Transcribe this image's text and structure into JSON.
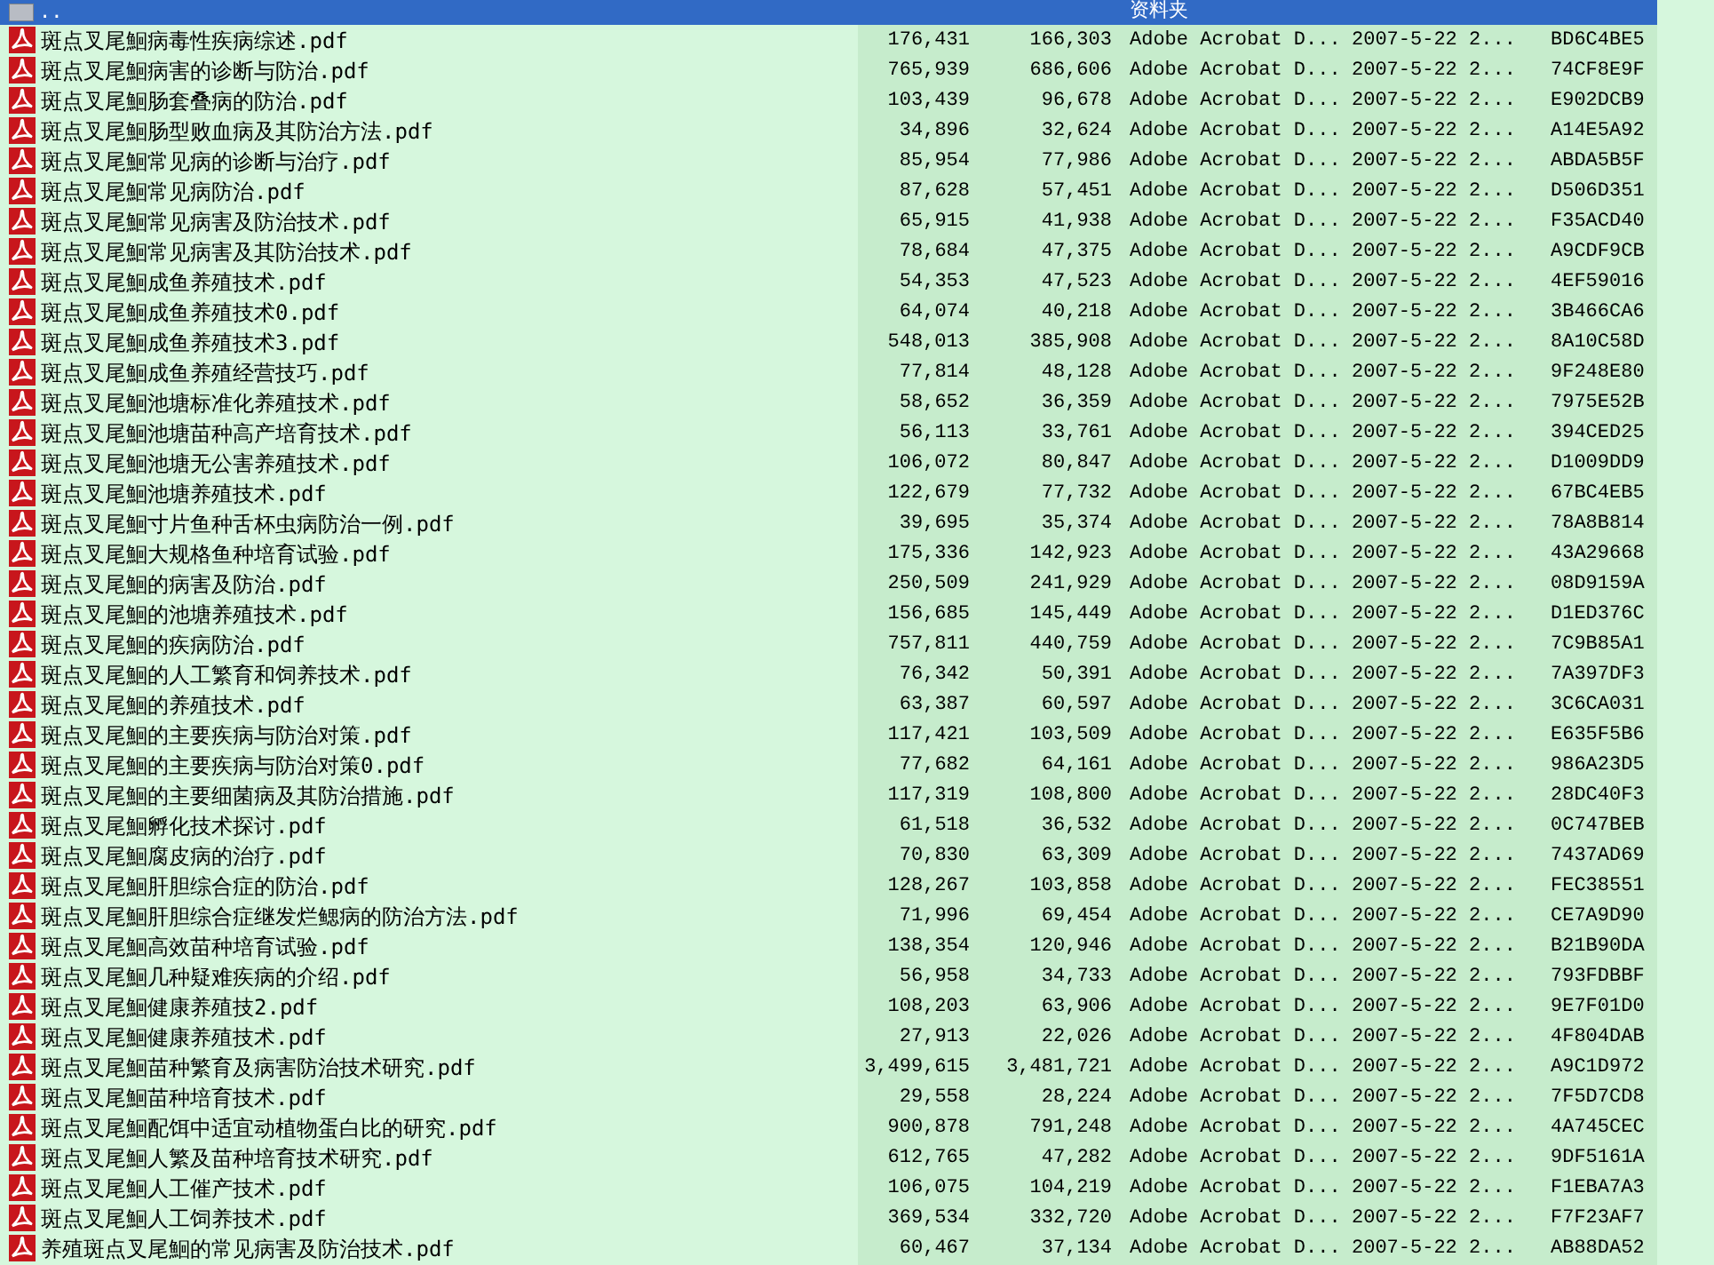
{
  "file_list": {
    "rows": [
      {
        "kind": "parent",
        "name": "..",
        "type": "资料夹",
        "selected": true
      },
      {
        "kind": "file",
        "name": "斑点叉尾鮰病毒性疾病综述.pdf",
        "size": "176,431",
        "packed": "166,303",
        "type": "Adobe Acrobat D...",
        "modified": "2007-5-22 2...",
        "crc": "BD6C4BE5",
        "selected": false
      },
      {
        "kind": "file",
        "name": "斑点叉尾鮰病害的诊断与防治.pdf",
        "size": "765,939",
        "packed": "686,606",
        "type": "Adobe Acrobat D...",
        "modified": "2007-5-22 2...",
        "crc": "74CF8E9F",
        "selected": false
      },
      {
        "kind": "file",
        "name": "斑点叉尾鮰肠套叠病的防治.pdf",
        "size": "103,439",
        "packed": "96,678",
        "type": "Adobe Acrobat D...",
        "modified": "2007-5-22 2...",
        "crc": "E902DCB9",
        "selected": false
      },
      {
        "kind": "file",
        "name": "斑点叉尾鮰肠型败血病及其防治方法.pdf",
        "size": "34,896",
        "packed": "32,624",
        "type": "Adobe Acrobat D...",
        "modified": "2007-5-22 2...",
        "crc": "A14E5A92",
        "selected": false
      },
      {
        "kind": "file",
        "name": "斑点叉尾鮰常见病的诊断与治疗.pdf",
        "size": "85,954",
        "packed": "77,986",
        "type": "Adobe Acrobat D...",
        "modified": "2007-5-22 2...",
        "crc": "ABDA5B5F",
        "selected": false
      },
      {
        "kind": "file",
        "name": "斑点叉尾鮰常见病防治.pdf",
        "size": "87,628",
        "packed": "57,451",
        "type": "Adobe Acrobat D...",
        "modified": "2007-5-22 2...",
        "crc": "D506D351",
        "selected": false
      },
      {
        "kind": "file",
        "name": "斑点叉尾鮰常见病害及防治技术.pdf",
        "size": "65,915",
        "packed": "41,938",
        "type": "Adobe Acrobat D...",
        "modified": "2007-5-22 2...",
        "crc": "F35ACD40",
        "selected": false
      },
      {
        "kind": "file",
        "name": "斑点叉尾鮰常见病害及其防治技术.pdf",
        "size": "78,684",
        "packed": "47,375",
        "type": "Adobe Acrobat D...",
        "modified": "2007-5-22 2...",
        "crc": "A9CDF9CB",
        "selected": false
      },
      {
        "kind": "file",
        "name": "斑点叉尾鮰成鱼养殖技术.pdf",
        "size": "54,353",
        "packed": "47,523",
        "type": "Adobe Acrobat D...",
        "modified": "2007-5-22 2...",
        "crc": "4EF59016",
        "selected": false
      },
      {
        "kind": "file",
        "name": "斑点叉尾鮰成鱼养殖技术0.pdf",
        "size": "64,074",
        "packed": "40,218",
        "type": "Adobe Acrobat D...",
        "modified": "2007-5-22 2...",
        "crc": "3B466CA6",
        "selected": false
      },
      {
        "kind": "file",
        "name": "斑点叉尾鮰成鱼养殖技术3.pdf",
        "size": "548,013",
        "packed": "385,908",
        "type": "Adobe Acrobat D...",
        "modified": "2007-5-22 2...",
        "crc": "8A10C58D",
        "selected": false
      },
      {
        "kind": "file",
        "name": "斑点叉尾鮰成鱼养殖经营技巧.pdf",
        "size": "77,814",
        "packed": "48,128",
        "type": "Adobe Acrobat D...",
        "modified": "2007-5-22 2...",
        "crc": "9F248E80",
        "selected": false
      },
      {
        "kind": "file",
        "name": "斑点叉尾鮰池塘标准化养殖技术.pdf",
        "size": "58,652",
        "packed": "36,359",
        "type": "Adobe Acrobat D...",
        "modified": "2007-5-22 2...",
        "crc": "7975E52B",
        "selected": false
      },
      {
        "kind": "file",
        "name": "斑点叉尾鮰池塘苗种高产培育技术.pdf",
        "size": "56,113",
        "packed": "33,761",
        "type": "Adobe Acrobat D...",
        "modified": "2007-5-22 2...",
        "crc": "394CED25",
        "selected": false
      },
      {
        "kind": "file",
        "name": "斑点叉尾鮰池塘无公害养殖技术.pdf",
        "size": "106,072",
        "packed": "80,847",
        "type": "Adobe Acrobat D...",
        "modified": "2007-5-22 2...",
        "crc": "D1009DD9",
        "selected": false
      },
      {
        "kind": "file",
        "name": "斑点叉尾鮰池塘养殖技术.pdf",
        "size": "122,679",
        "packed": "77,732",
        "type": "Adobe Acrobat D...",
        "modified": "2007-5-22 2...",
        "crc": "67BC4EB5",
        "selected": false
      },
      {
        "kind": "file",
        "name": "斑点叉尾鮰寸片鱼种舌杯虫病防治一例.pdf",
        "size": "39,695",
        "packed": "35,374",
        "type": "Adobe Acrobat D...",
        "modified": "2007-5-22 2...",
        "crc": "78A8B814",
        "selected": false
      },
      {
        "kind": "file",
        "name": "斑点叉尾鮰大规格鱼种培育试验.pdf",
        "size": "175,336",
        "packed": "142,923",
        "type": "Adobe Acrobat D...",
        "modified": "2007-5-22 2...",
        "crc": "43A29668",
        "selected": false
      },
      {
        "kind": "file",
        "name": "斑点叉尾鮰的病害及防治.pdf",
        "size": "250,509",
        "packed": "241,929",
        "type": "Adobe Acrobat D...",
        "modified": "2007-5-22 2...",
        "crc": "08D9159A",
        "selected": false
      },
      {
        "kind": "file",
        "name": "斑点叉尾鮰的池塘养殖技术.pdf",
        "size": "156,685",
        "packed": "145,449",
        "type": "Adobe Acrobat D...",
        "modified": "2007-5-22 2...",
        "crc": "D1ED376C",
        "selected": false
      },
      {
        "kind": "file",
        "name": "斑点叉尾鮰的疾病防治.pdf",
        "size": "757,811",
        "packed": "440,759",
        "type": "Adobe Acrobat D...",
        "modified": "2007-5-22 2...",
        "crc": "7C9B85A1",
        "selected": false
      },
      {
        "kind": "file",
        "name": "斑点叉尾鮰的人工繁育和饲养技术.pdf",
        "size": "76,342",
        "packed": "50,391",
        "type": "Adobe Acrobat D...",
        "modified": "2007-5-22 2...",
        "crc": "7A397DF3",
        "selected": false
      },
      {
        "kind": "file",
        "name": "斑点叉尾鮰的养殖技术.pdf",
        "size": "63,387",
        "packed": "60,597",
        "type": "Adobe Acrobat D...",
        "modified": "2007-5-22 2...",
        "crc": "3C6CA031",
        "selected": false
      },
      {
        "kind": "file",
        "name": "斑点叉尾鮰的主要疾病与防治对策.pdf",
        "size": "117,421",
        "packed": "103,509",
        "type": "Adobe Acrobat D...",
        "modified": "2007-5-22 2...",
        "crc": "E635F5B6",
        "selected": false
      },
      {
        "kind": "file",
        "name": "斑点叉尾鮰的主要疾病与防治对策0.pdf",
        "size": "77,682",
        "packed": "64,161",
        "type": "Adobe Acrobat D...",
        "modified": "2007-5-22 2...",
        "crc": "986A23D5",
        "selected": false
      },
      {
        "kind": "file",
        "name": "斑点叉尾鮰的主要细菌病及其防治措施.pdf",
        "size": "117,319",
        "packed": "108,800",
        "type": "Adobe Acrobat D...",
        "modified": "2007-5-22 2...",
        "crc": "28DC40F3",
        "selected": false
      },
      {
        "kind": "file",
        "name": "斑点叉尾鮰孵化技术探讨.pdf",
        "size": "61,518",
        "packed": "36,532",
        "type": "Adobe Acrobat D...",
        "modified": "2007-5-22 2...",
        "crc": "0C747BEB",
        "selected": false
      },
      {
        "kind": "file",
        "name": "斑点叉尾鮰腐皮病的治疗.pdf",
        "size": "70,830",
        "packed": "63,309",
        "type": "Adobe Acrobat D...",
        "modified": "2007-5-22 2...",
        "crc": "7437AD69",
        "selected": false
      },
      {
        "kind": "file",
        "name": "斑点叉尾鮰肝胆综合症的防治.pdf",
        "size": "128,267",
        "packed": "103,858",
        "type": "Adobe Acrobat D...",
        "modified": "2007-5-22 2...",
        "crc": "FEC38551",
        "selected": false
      },
      {
        "kind": "file",
        "name": "斑点叉尾鮰肝胆综合症继发烂鳃病的防治方法.pdf",
        "size": "71,996",
        "packed": "69,454",
        "type": "Adobe Acrobat D...",
        "modified": "2007-5-22 2...",
        "crc": "CE7A9D90",
        "selected": false
      },
      {
        "kind": "file",
        "name": "斑点叉尾鮰高效苗种培育试验.pdf",
        "size": "138,354",
        "packed": "120,946",
        "type": "Adobe Acrobat D...",
        "modified": "2007-5-22 2...",
        "crc": "B21B90DA",
        "selected": false
      },
      {
        "kind": "file",
        "name": "斑点叉尾鮰几种疑难疾病的介绍.pdf",
        "size": "56,958",
        "packed": "34,733",
        "type": "Adobe Acrobat D...",
        "modified": "2007-5-22 2...",
        "crc": "793FDBBF",
        "selected": false
      },
      {
        "kind": "file",
        "name": "斑点叉尾鮰健康养殖技2.pdf",
        "size": "108,203",
        "packed": "63,906",
        "type": "Adobe Acrobat D...",
        "modified": "2007-5-22 2...",
        "crc": "9E7F01D0",
        "selected": false
      },
      {
        "kind": "file",
        "name": "斑点叉尾鮰健康养殖技术.pdf",
        "size": "27,913",
        "packed": "22,026",
        "type": "Adobe Acrobat D...",
        "modified": "2007-5-22 2...",
        "crc": "4F804DAB",
        "selected": false
      },
      {
        "kind": "file",
        "name": "斑点叉尾鮰苗种繁育及病害防治技术研究.pdf",
        "size": "3,499,615",
        "packed": "3,481,721",
        "type": "Adobe Acrobat D...",
        "modified": "2007-5-22 2...",
        "crc": "A9C1D972",
        "selected": false
      },
      {
        "kind": "file",
        "name": "斑点叉尾鮰苗种培育技术.pdf",
        "size": "29,558",
        "packed": "28,224",
        "type": "Adobe Acrobat D...",
        "modified": "2007-5-22 2...",
        "crc": "7F5D7CD8",
        "selected": false
      },
      {
        "kind": "file",
        "name": "斑点叉尾鮰配饵中适宜动植物蛋白比的研究.pdf",
        "size": "900,878",
        "packed": "791,248",
        "type": "Adobe Acrobat D...",
        "modified": "2007-5-22 2...",
        "crc": "4A745CEC",
        "selected": false
      },
      {
        "kind": "file",
        "name": "斑点叉尾鮰人繁及苗种培育技术研究.pdf",
        "size": "612,765",
        "packed": "47,282",
        "type": "Adobe Acrobat D...",
        "modified": "2007-5-22 2...",
        "crc": "9DF5161A",
        "selected": false
      },
      {
        "kind": "file",
        "name": "斑点叉尾鮰人工催产技术.pdf",
        "size": "106,075",
        "packed": "104,219",
        "type": "Adobe Acrobat D...",
        "modified": "2007-5-22 2...",
        "crc": "F1EBA7A3",
        "selected": false
      },
      {
        "kind": "file",
        "name": "斑点叉尾鮰人工饲养技术.pdf",
        "size": "369,534",
        "packed": "332,720",
        "type": "Adobe Acrobat D...",
        "modified": "2007-5-22 2...",
        "crc": "F7F23AF7",
        "selected": false
      },
      {
        "kind": "file",
        "name": "养殖斑点叉尾鮰的常见病害及防治技术.pdf",
        "size": "60,467",
        "packed": "37,134",
        "type": "Adobe Acrobat D...",
        "modified": "2007-5-22 2...",
        "crc": "AB88DA52",
        "selected": false
      }
    ]
  }
}
